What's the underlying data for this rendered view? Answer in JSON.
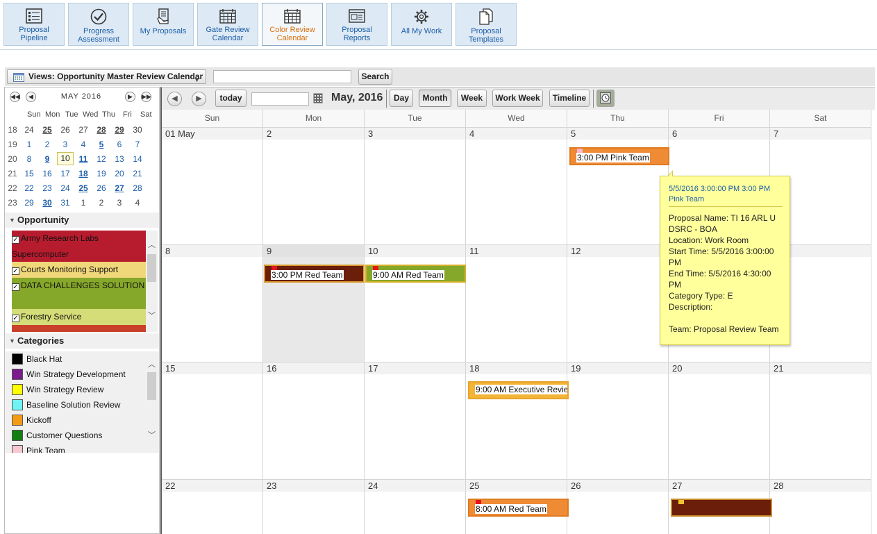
{
  "nav": [
    {
      "label_line1": "Proposal",
      "label_line2": "Pipeline",
      "icon": "list-icon"
    },
    {
      "label_line1": "Progress",
      "label_line2": "Assessment",
      "icon": "checkmark-icon"
    },
    {
      "label_line1": "My Proposals",
      "label_line2": "",
      "icon": "document-hand-icon"
    },
    {
      "label_line1": "Gate Review",
      "label_line2": "Calendar",
      "icon": "calendar-icon"
    },
    {
      "label_line1": "Color Review",
      "label_line2": "Calendar",
      "icon": "calendar-icon",
      "active": true
    },
    {
      "label_line1": "Proposal",
      "label_line2": "Reports",
      "icon": "report-icon"
    },
    {
      "label_line1": "All My Work",
      "label_line2": "",
      "icon": "gear-icon"
    },
    {
      "label_line1": "Proposal",
      "label_line2": "Templates",
      "icon": "templates-icon"
    }
  ],
  "views": {
    "label": "Views: Opportunity Master Review Calendar",
    "search_value": "",
    "search_button": "Search"
  },
  "mini_calendar": {
    "title": "MAY 2016",
    "weekday_headers": [
      "Sun",
      "Mon",
      "Tue",
      "Wed",
      "Thu",
      "Fri",
      "Sat"
    ],
    "weeks": [
      {
        "num": "18",
        "days": [
          "24",
          "25",
          "26",
          "27",
          "28",
          "29",
          "30"
        ]
      },
      {
        "num": "19",
        "days": [
          "1",
          "2",
          "3",
          "4",
          "5",
          "6",
          "7"
        ]
      },
      {
        "num": "20",
        "days": [
          "8",
          "9",
          "10",
          "11",
          "12",
          "13",
          "14"
        ]
      },
      {
        "num": "21",
        "days": [
          "15",
          "16",
          "17",
          "18",
          "19",
          "20",
          "21"
        ]
      },
      {
        "num": "22",
        "days": [
          "22",
          "23",
          "24",
          "25",
          "26",
          "27",
          "28"
        ]
      },
      {
        "num": "23",
        "days": [
          "29",
          "30",
          "31",
          "1",
          "2",
          "3",
          "4"
        ]
      }
    ]
  },
  "opportunity": {
    "heading": "Opportunity",
    "items": [
      {
        "label": "Army Research Labs Supercomputer",
        "color": "#b71c2e",
        "checked": true
      },
      {
        "label": "Courts Monitoring Support",
        "color": "#f0d77a",
        "checked": true
      },
      {
        "label": "DATA CHALLENGES SOLUTION",
        "color": "#86a82a",
        "checked": true
      },
      {
        "label": "Forestry Service",
        "color": "#d4dd78",
        "checked": true
      }
    ]
  },
  "categories": {
    "heading": "Categories",
    "items": [
      {
        "label": "Black Hat",
        "color": "#000000"
      },
      {
        "label": "Win Strategy Development",
        "color": "#7b1a8c"
      },
      {
        "label": "Win Strategy Review",
        "color": "#ffff00"
      },
      {
        "label": "Baseline Solution Review",
        "color": "#6ff3f3"
      },
      {
        "label": "Kickoff",
        "color": "#f39b12"
      },
      {
        "label": "Customer Questions",
        "color": "#137f13"
      },
      {
        "label": "Pink Team",
        "color": "#f7c7d2"
      }
    ]
  },
  "toolbar": {
    "today": "today",
    "date_value": "",
    "title": "May, 2016",
    "day": "Day",
    "month": "Month",
    "week": "Week",
    "work_week": "Work Week",
    "timeline": "Timeline"
  },
  "weekdays": [
    "Sun",
    "Mon",
    "Tue",
    "Wed",
    "Thu",
    "Fri",
    "Sat"
  ],
  "month_weeks": [
    {
      "days": [
        "01 May",
        "2",
        "3",
        "4",
        "5",
        "6",
        "7"
      ]
    },
    {
      "days": [
        "8",
        "9",
        "10",
        "11",
        "12",
        "13",
        "14"
      ]
    },
    {
      "days": [
        "15",
        "16",
        "17",
        "18",
        "19",
        "20",
        "21"
      ]
    },
    {
      "days": [
        "22",
        "23",
        "24",
        "25",
        "26",
        "27",
        "28"
      ]
    }
  ],
  "events": [
    {
      "week": 0,
      "day": 4,
      "label": "3:00 PM Pink Team",
      "color": "#ef8a35",
      "border": "#e07a20",
      "flag": "#f7b8d0"
    },
    {
      "week": 1,
      "day": 1,
      "label": "3:00 PM Red Team",
      "color": "#6b1e0a",
      "border": "#d79a2a",
      "flag": "#e8141c"
    },
    {
      "week": 1,
      "day": 2,
      "label": "9:00 AM Red Team",
      "color": "#86a82a",
      "border": "#d7b02a",
      "flag": "#e8141c"
    },
    {
      "week": 2,
      "day": 3,
      "label": "9:00 AM Executive Revie",
      "color": "#f3b437",
      "border": "#e7a52a",
      "flag": ""
    },
    {
      "week": 3,
      "day": 3,
      "label": "8:00 AM Red Team",
      "color": "#ef8a35",
      "border": "#e07a20",
      "flag": "#e8141c"
    },
    {
      "week": 3,
      "day": 5,
      "label": "",
      "color": "#6b1e0a",
      "border": "#c78a25",
      "flag": "#f2c233"
    }
  ],
  "tooltip": {
    "header": "5/5/2016 3:00:00 PM 3:00 PM Pink Team",
    "proposal": "Proposal Name: TI 16 ARL U DSRC - BOA",
    "location": "Location: Work Room",
    "start": "Start Time: 5/5/2016 3:00:00 PM",
    "end": "End Time: 5/5/2016 4:30:00 PM",
    "category": "Category Type: E",
    "description": "Description:",
    "team": "Team: Proposal Review Team"
  }
}
